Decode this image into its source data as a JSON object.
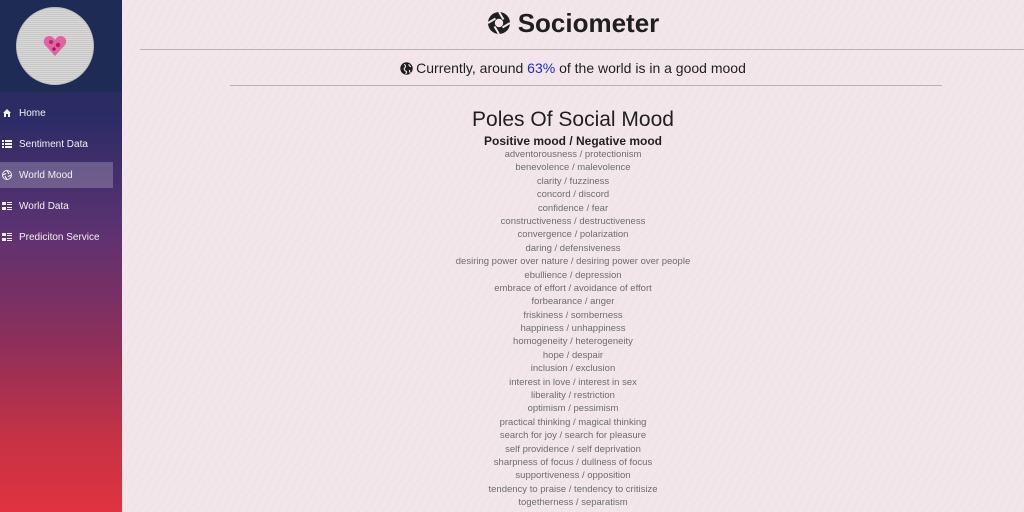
{
  "app": {
    "title": "Sociometer",
    "logo_icon": "aperture-icon"
  },
  "sidebar": {
    "avatar_icon": "heart-icon",
    "items": [
      {
        "label": "Home",
        "icon": "home-icon",
        "active": false
      },
      {
        "label": "Sentiment Data",
        "icon": "list-icon",
        "active": false
      },
      {
        "label": "World Mood",
        "icon": "aperture-icon",
        "active": true
      },
      {
        "label": "World Data",
        "icon": "grid-list-icon",
        "active": false
      },
      {
        "label": "Prediciton Service",
        "icon": "grid-list-icon",
        "active": false
      }
    ]
  },
  "mood_banner": {
    "icon": "globe-icon",
    "prefix": "Currently, around ",
    "percent": "63%",
    "suffix": " of the world is in a good mood"
  },
  "poles": {
    "title": "Poles Of Social Mood",
    "subtitle": "Positive mood / Negative mood",
    "items": [
      "adventorousness / protectionism",
      "benevolence / malevolence",
      "clarity / fuzziness",
      "concord / discord",
      "confidence / fear",
      "constructiveness / destructiveness",
      "convergence / polarization",
      "daring / defensiveness",
      "desiring power over nature / desiring power over people",
      "ebullience / depression",
      "embrace of effort / avoidance of effort",
      "forbearance / anger",
      "friskiness / somberness",
      "happiness / unhappiness",
      "homogeneity / heterogeneity",
      "hope / despair",
      "inclusion / exclusion",
      "interest in love / interest in sex",
      "liberality / restriction",
      "optimism / pessimism",
      "practical thinking / magical thinking",
      "search for joy / search for pleasure",
      "self providence / self deprivation",
      "sharpness of focus / dullness of focus",
      "supportiveness / opposition",
      "tendency to praise / tendency to critisize",
      "togetherness / separatism"
    ]
  },
  "colors": {
    "accent_percent": "#1f2ad6",
    "sidebar_top": "#1b2a4e",
    "sidebar_bottom": "#e0333f"
  }
}
